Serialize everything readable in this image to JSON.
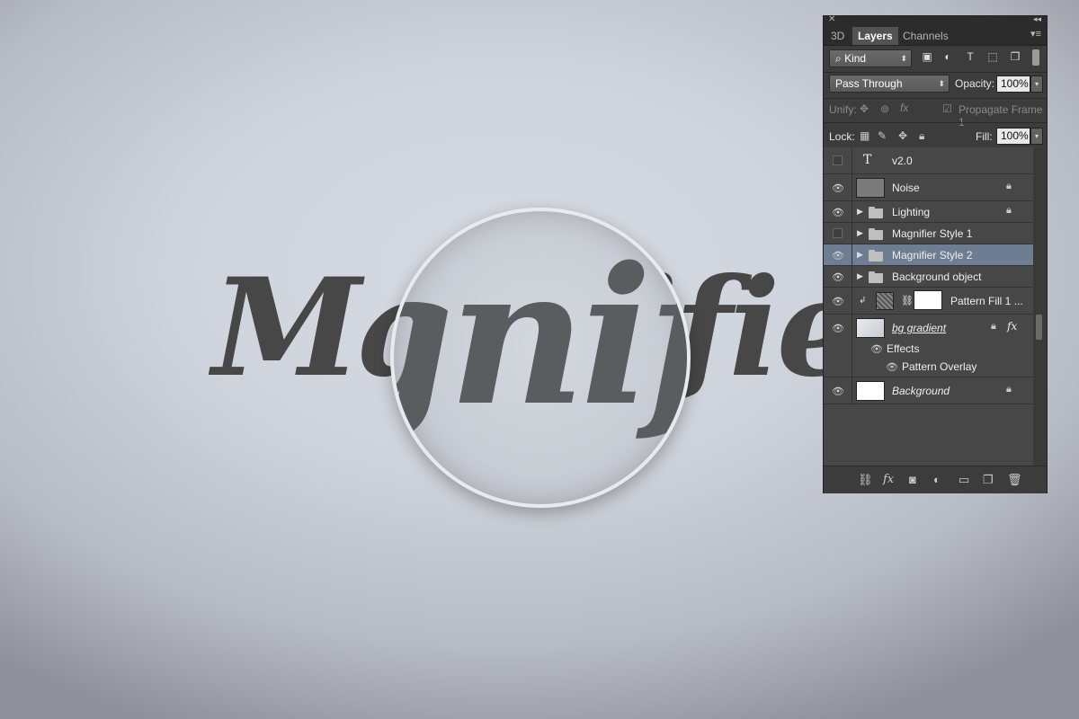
{
  "canvas": {
    "main_text": "Magnifier",
    "magnified_text": "agnifi"
  },
  "panel": {
    "tabs": [
      "3D",
      "Layers",
      "Channels"
    ],
    "active_tab": "Layers",
    "filter": {
      "label": "Kind"
    },
    "blend_mode": "Pass Through",
    "opacity_label": "Opacity:",
    "opacity_value": "100%",
    "unify_label": "Unify:",
    "propagate_label": "Propagate Frame 1",
    "lock_label": "Lock:",
    "fill_label": "Fill:",
    "fill_value": "100%",
    "layers": [
      {
        "name": "v2.0",
        "type": "text",
        "visible": false
      },
      {
        "name": "Noise",
        "type": "pixel",
        "visible": true,
        "locked": true
      },
      {
        "name": "Lighting",
        "type": "group",
        "visible": true,
        "locked": true
      },
      {
        "name": "Magnifier Style 1",
        "type": "group",
        "visible": false
      },
      {
        "name": "Magnifier Style 2",
        "type": "group",
        "visible": true,
        "selected": true
      },
      {
        "name": "Background object",
        "type": "group",
        "visible": true
      },
      {
        "name": "Pattern Fill 1 ...",
        "type": "fill",
        "visible": true
      },
      {
        "name": "bg gradient",
        "type": "pixel",
        "visible": true,
        "locked": true,
        "fx": "fx"
      },
      {
        "name": "Effects",
        "type": "effects"
      },
      {
        "name": "Pattern Overlay",
        "type": "effect"
      },
      {
        "name": "Background",
        "type": "background",
        "visible": true,
        "locked": true
      }
    ]
  },
  "colors": {
    "panel_bg": "#3c3c3c",
    "selection": "#6e7d92",
    "text_dark": "#474747"
  }
}
